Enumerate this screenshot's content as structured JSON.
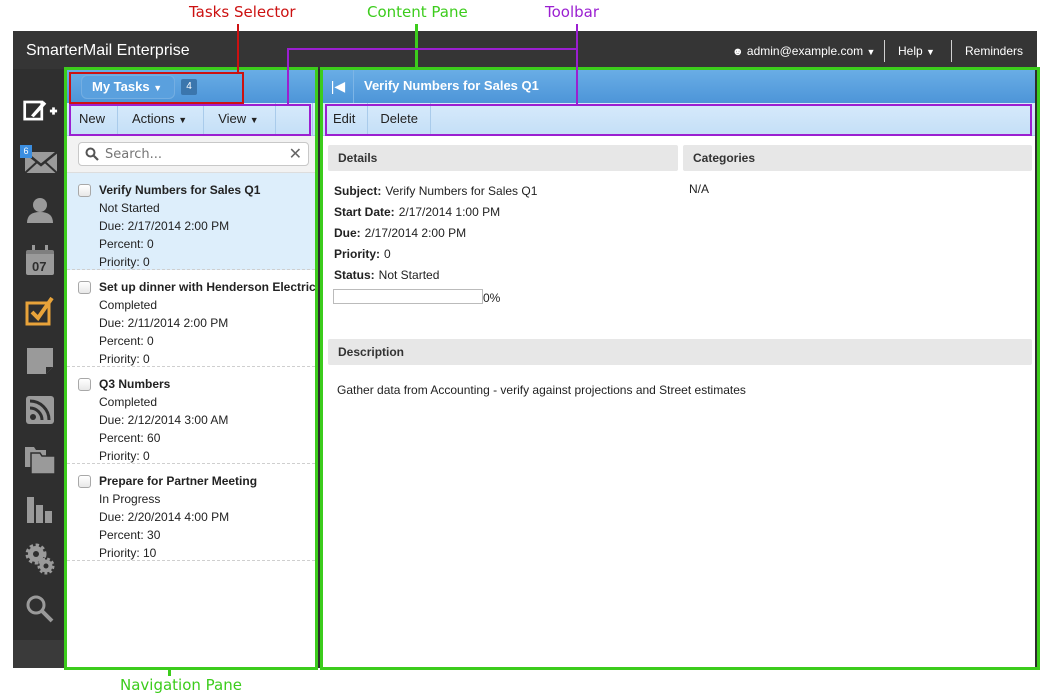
{
  "annotations": {
    "tasks_selector": "Tasks Selector",
    "content_pane": "Content Pane",
    "toolbar": "Toolbar",
    "navigation_pane": "Navigation Pane"
  },
  "colors": {
    "annotation_green": "#3ccc1c",
    "annotation_purple": "#9b1fd1",
    "annotation_red": "#cc1111",
    "header_blue": "#5aa0de",
    "toolbar_blue": "#cfe6fa",
    "selected_row": "#ddeefb",
    "tasks_icon_active": "#e8a33a"
  },
  "topbar": {
    "brand": "SmarterMail Enterprise",
    "user": "admin@example.com",
    "help": "Help",
    "reminders": "Reminders"
  },
  "rail": {
    "mail_badge": "6",
    "calendar_day": "07",
    "icons": [
      "compose-icon",
      "mail-icon",
      "contacts-icon",
      "calendar-icon",
      "tasks-icon",
      "notes-icon",
      "rss-icon",
      "files-icon",
      "reports-icon",
      "settings-icon",
      "search-icon"
    ]
  },
  "nav": {
    "selector_label": "My Tasks",
    "count": "4",
    "toolbar": {
      "new": "New",
      "actions": "Actions",
      "view": "View"
    },
    "search_placeholder": "Search...",
    "tasks": [
      {
        "title": "Verify Numbers for Sales Q1",
        "status": "Not Started",
        "due": "Due: 2/17/2014 2:00 PM",
        "percent": "Percent: 0",
        "priority": "Priority: 0"
      },
      {
        "title": "Set up dinner with Henderson Electric",
        "status": "Completed",
        "due": "Due: 2/11/2014 2:00 PM",
        "percent": "Percent: 0",
        "priority": "Priority: 0"
      },
      {
        "title": "Q3 Numbers",
        "status": "Completed",
        "due": "Due: 2/12/2014 3:00 AM",
        "percent": "Percent: 60",
        "priority": "Priority: 0"
      },
      {
        "title": "Prepare for Partner Meeting",
        "status": "In Progress",
        "due": "Due: 2/20/2014 4:00 PM",
        "percent": "Percent: 30",
        "priority": "Priority: 10"
      }
    ]
  },
  "content": {
    "title": "Verify Numbers for Sales Q1",
    "toolbar": {
      "edit": "Edit",
      "delete": "Delete"
    },
    "details_header": "Details",
    "categories_header": "Categories",
    "categories_value": "N/A",
    "fields": {
      "subject_label": "Subject:",
      "subject": "Verify Numbers for Sales Q1",
      "start_label": "Start Date:",
      "start": "2/17/2014 1:00 PM",
      "due_label": "Due:",
      "due": "2/17/2014 2:00 PM",
      "priority_label": "Priority:",
      "priority": "0",
      "status_label": "Status:",
      "status": "Not Started"
    },
    "progress_percent": 0,
    "progress_text": "0%",
    "description_header": "Description",
    "description": "Gather data from Accounting - verify against projections and Street estimates"
  }
}
